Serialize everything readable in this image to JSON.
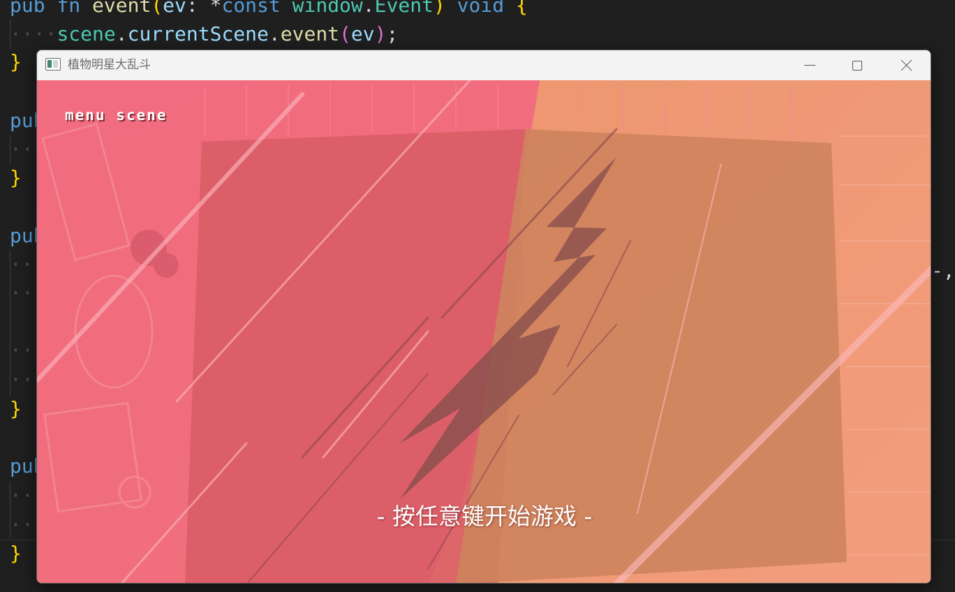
{
  "editor": {
    "lines": [
      {
        "tokens": [
          {
            "t": "pub ",
            "c": "kw"
          },
          {
            "t": "fn ",
            "c": "kw"
          },
          {
            "t": "event",
            "c": "fn"
          },
          {
            "t": "(",
            "c": "brace"
          },
          {
            "t": "ev",
            "c": "param"
          },
          {
            "t": ": *",
            "c": "punct"
          },
          {
            "t": "const ",
            "c": "kw"
          },
          {
            "t": "window",
            "c": "type"
          },
          {
            "t": ".",
            "c": "punct"
          },
          {
            "t": "Event",
            "c": "type"
          },
          {
            "t": ") ",
            "c": "brace"
          },
          {
            "t": "void ",
            "c": "kw"
          },
          {
            "t": "{",
            "c": "brace"
          }
        ]
      },
      {
        "tokens": [
          {
            "t": "····",
            "c": "dots"
          },
          {
            "t": "scene",
            "c": "type"
          },
          {
            "t": ".",
            "c": "punct"
          },
          {
            "t": "currentScene",
            "c": "param"
          },
          {
            "t": ".",
            "c": "punct"
          },
          {
            "t": "event",
            "c": "fn"
          },
          {
            "t": "(",
            "c": "paren2"
          },
          {
            "t": "ev",
            "c": "param"
          },
          {
            "t": ")",
            "c": "paren2"
          },
          {
            "t": ";",
            "c": "punct"
          }
        ]
      },
      {
        "tokens": [
          {
            "t": "}",
            "c": "brace"
          }
        ]
      },
      {
        "tokens": [
          {
            "t": "pub",
            "c": "kw"
          }
        ]
      },
      {
        "tokens": [
          {
            "t": "··",
            "c": "dots"
          }
        ]
      },
      {
        "tokens": [
          {
            "t": "}",
            "c": "brace"
          }
        ]
      },
      {
        "tokens": [
          {
            "t": "pub",
            "c": "kw"
          }
        ]
      },
      {
        "tokens": [
          {
            "t": "··",
            "c": "dots"
          }
        ]
      },
      {
        "tokens": [
          {
            "t": "··",
            "c": "dots"
          }
        ]
      },
      {
        "tokens": [
          {
            "t": "··",
            "c": "dots"
          }
        ]
      },
      {
        "tokens": [
          {
            "t": "··",
            "c": "dots"
          }
        ]
      },
      {
        "tokens": [
          {
            "t": "}",
            "c": "brace"
          }
        ]
      },
      {
        "tokens": [
          {
            "t": "pub",
            "c": "kw"
          }
        ]
      },
      {
        "tokens": [
          {
            "t": "··",
            "c": "dots"
          }
        ]
      },
      {
        "tokens": [
          {
            "t": "··",
            "c": "dots"
          }
        ]
      },
      {
        "tokens": [
          {
            "t": "}",
            "c": "brace"
          }
        ]
      }
    ],
    "right_edge_text": "-,",
    "colors": {
      "background": "#1f1f1f",
      "keyword": "#569cd6",
      "function": "#dcdcaa",
      "parameter": "#9cdcfe",
      "type": "#4ec9b0",
      "brace": "#ffd700",
      "paren_nested": "#da70d6"
    }
  },
  "window": {
    "title": "植物明星大乱斗",
    "icon": "app-window-icon",
    "controls": {
      "minimize_icon": "minimize-icon",
      "maximize_icon": "maximize-icon",
      "close_icon": "close-icon"
    }
  },
  "game": {
    "scene_label": "menu scene",
    "start_hint": "- 按任意键开始游戏 -",
    "colors": {
      "left_tint": "#f26a7b",
      "right_tint": "#f0946a",
      "lightning": "#7a4a44"
    }
  }
}
